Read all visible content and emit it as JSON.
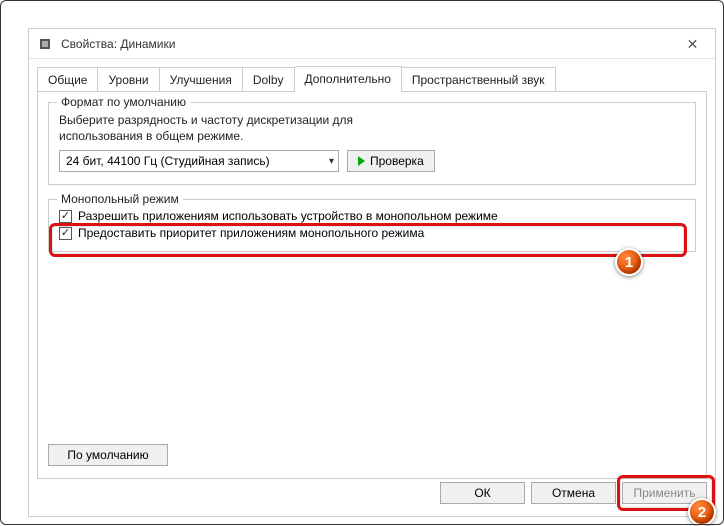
{
  "window": {
    "title": "Свойства: Динамики"
  },
  "tabs": {
    "items": [
      {
        "label": "Общие"
      },
      {
        "label": "Уровни"
      },
      {
        "label": "Улучшения"
      },
      {
        "label": "Dolby"
      },
      {
        "label": "Дополнительно"
      },
      {
        "label": "Пространственный звук"
      }
    ],
    "activeIndex": 4
  },
  "format_group": {
    "title": "Формат по умолчанию",
    "desc_line1": "Выберите разрядность и частоту дискретизации для",
    "desc_line2": "использования в общем режиме.",
    "combo_value": "24 бит, 44100 Гц (Студийная запись)",
    "test_label": "Проверка"
  },
  "mono_group": {
    "title": "Монопольный режим",
    "cb1_label": "Разрешить приложениям использовать устройство в монопольном режиме",
    "cb2_label": "Предоставить приоритет приложениям монопольного режима"
  },
  "defaults_btn": "По умолчанию",
  "footer": {
    "ok": "ОК",
    "cancel": "Отмена",
    "apply": "Применить"
  },
  "markers": {
    "one": "1",
    "two": "2"
  }
}
